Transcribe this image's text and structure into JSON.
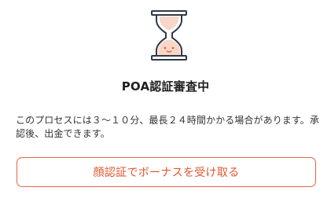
{
  "status": {
    "icon": "hourglass-icon",
    "title": "POA認証審査中",
    "description": "このプロセスには３～１０分、最長２４時間かかる場合があります。承認後、出金できます。"
  },
  "actions": {
    "cta_label": "顔認証でボーナスを受け取る"
  },
  "colors": {
    "accent": "#e3552e",
    "icon_sand": "#f8d6c8",
    "icon_stroke": "#2e3a45"
  }
}
